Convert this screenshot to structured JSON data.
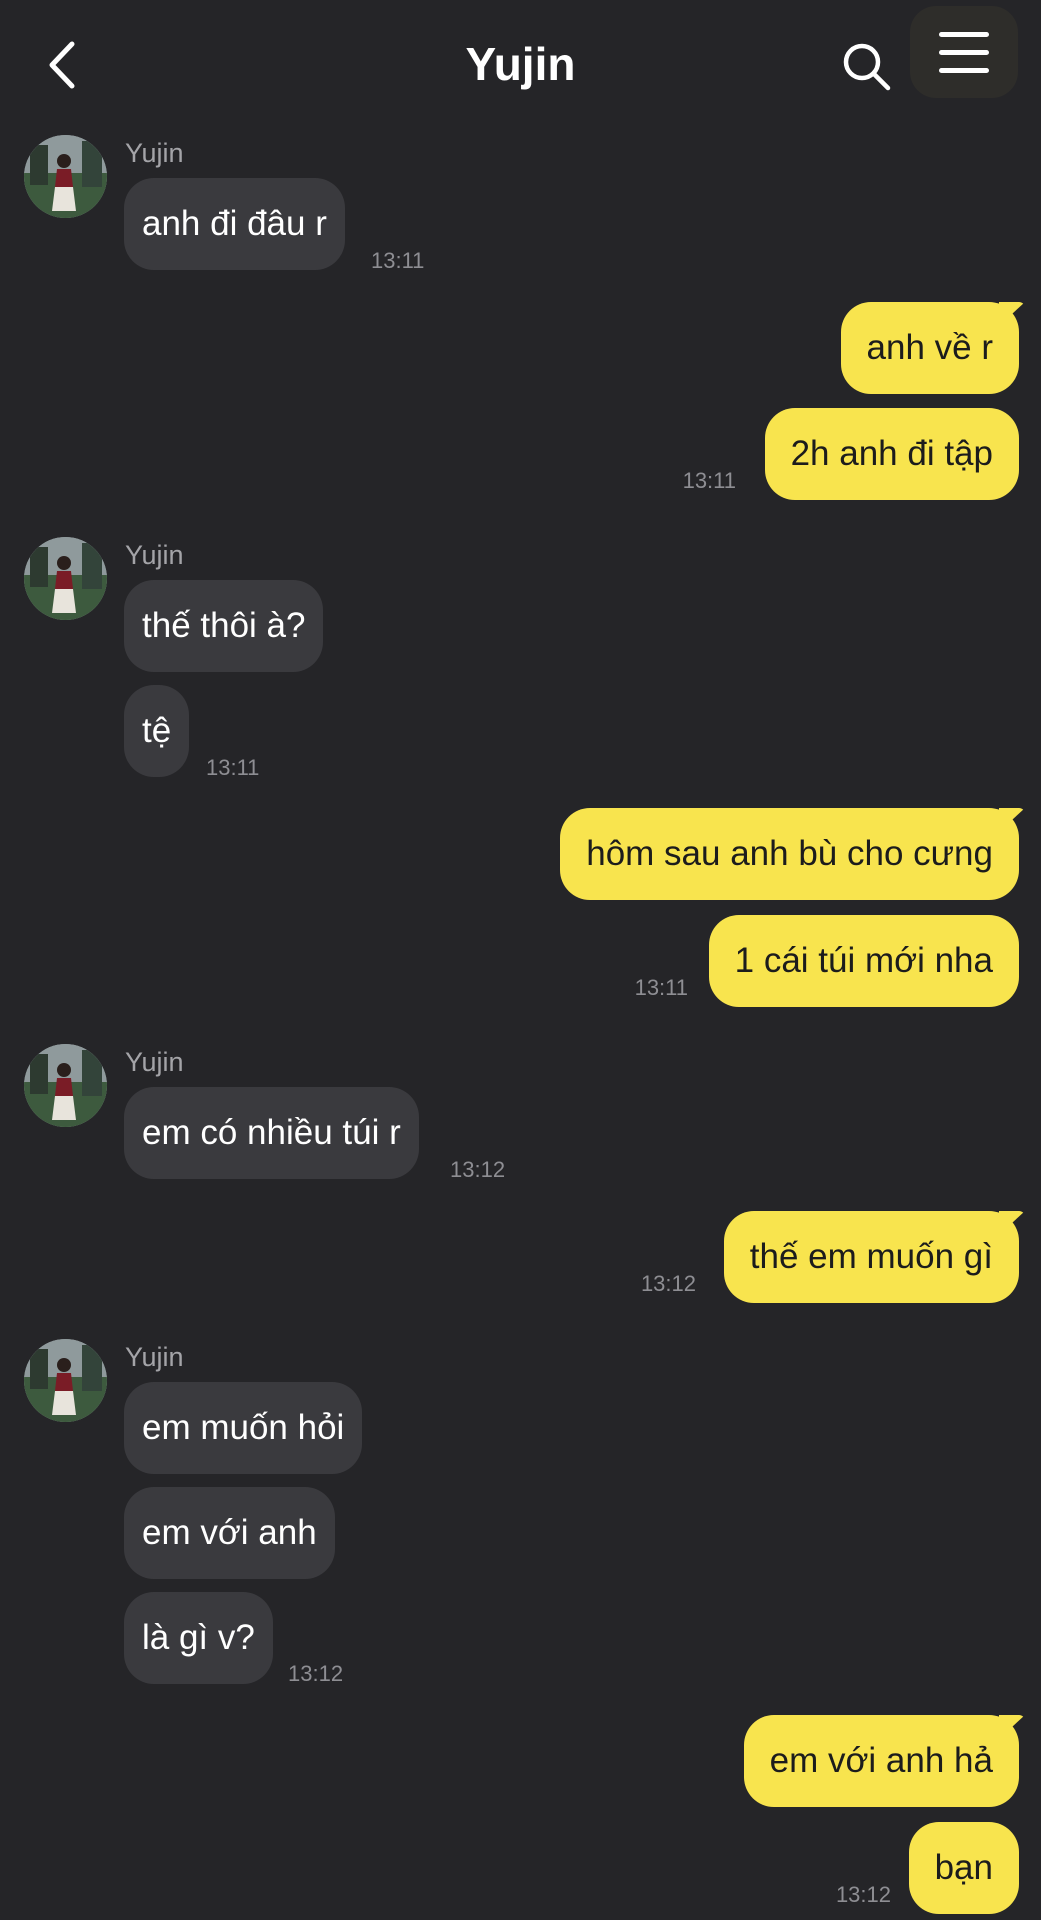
{
  "header": {
    "title": "Yujin",
    "back_icon": "chevron-left-icon",
    "search_icon": "search-icon",
    "menu_icon": "menu-icon"
  },
  "colors": {
    "background": "#252528",
    "incoming_bubble": "#3a3a3e",
    "outgoing_bubble": "#f8e44e",
    "timestamp": "#8e8e93"
  },
  "messages": {
    "g1": {
      "sender": "Yujin",
      "texts": [
        "anh đi đâu r"
      ],
      "time": "13:11"
    },
    "g2": {
      "texts": [
        "anh về r",
        "2h anh đi tập"
      ],
      "time": "13:11"
    },
    "g3": {
      "sender": "Yujin",
      "texts": [
        "thế thôi à?",
        "tệ"
      ],
      "time": "13:11"
    },
    "g4": {
      "texts": [
        "hôm sau anh bù cho cưng",
        "1 cái túi mới nha"
      ],
      "time": "13:11"
    },
    "g5": {
      "sender": "Yujin",
      "texts": [
        "em có nhiều túi r"
      ],
      "time": "13:12"
    },
    "g6": {
      "texts": [
        "thế em muốn gì"
      ],
      "time": "13:12"
    },
    "g7": {
      "sender": "Yujin",
      "texts": [
        "em muốn hỏi",
        "em với anh",
        "là gì v?"
      ],
      "time": "13:12"
    },
    "g8": {
      "texts": [
        "em với anh hả",
        "bạn"
      ],
      "time": "13:12"
    }
  }
}
